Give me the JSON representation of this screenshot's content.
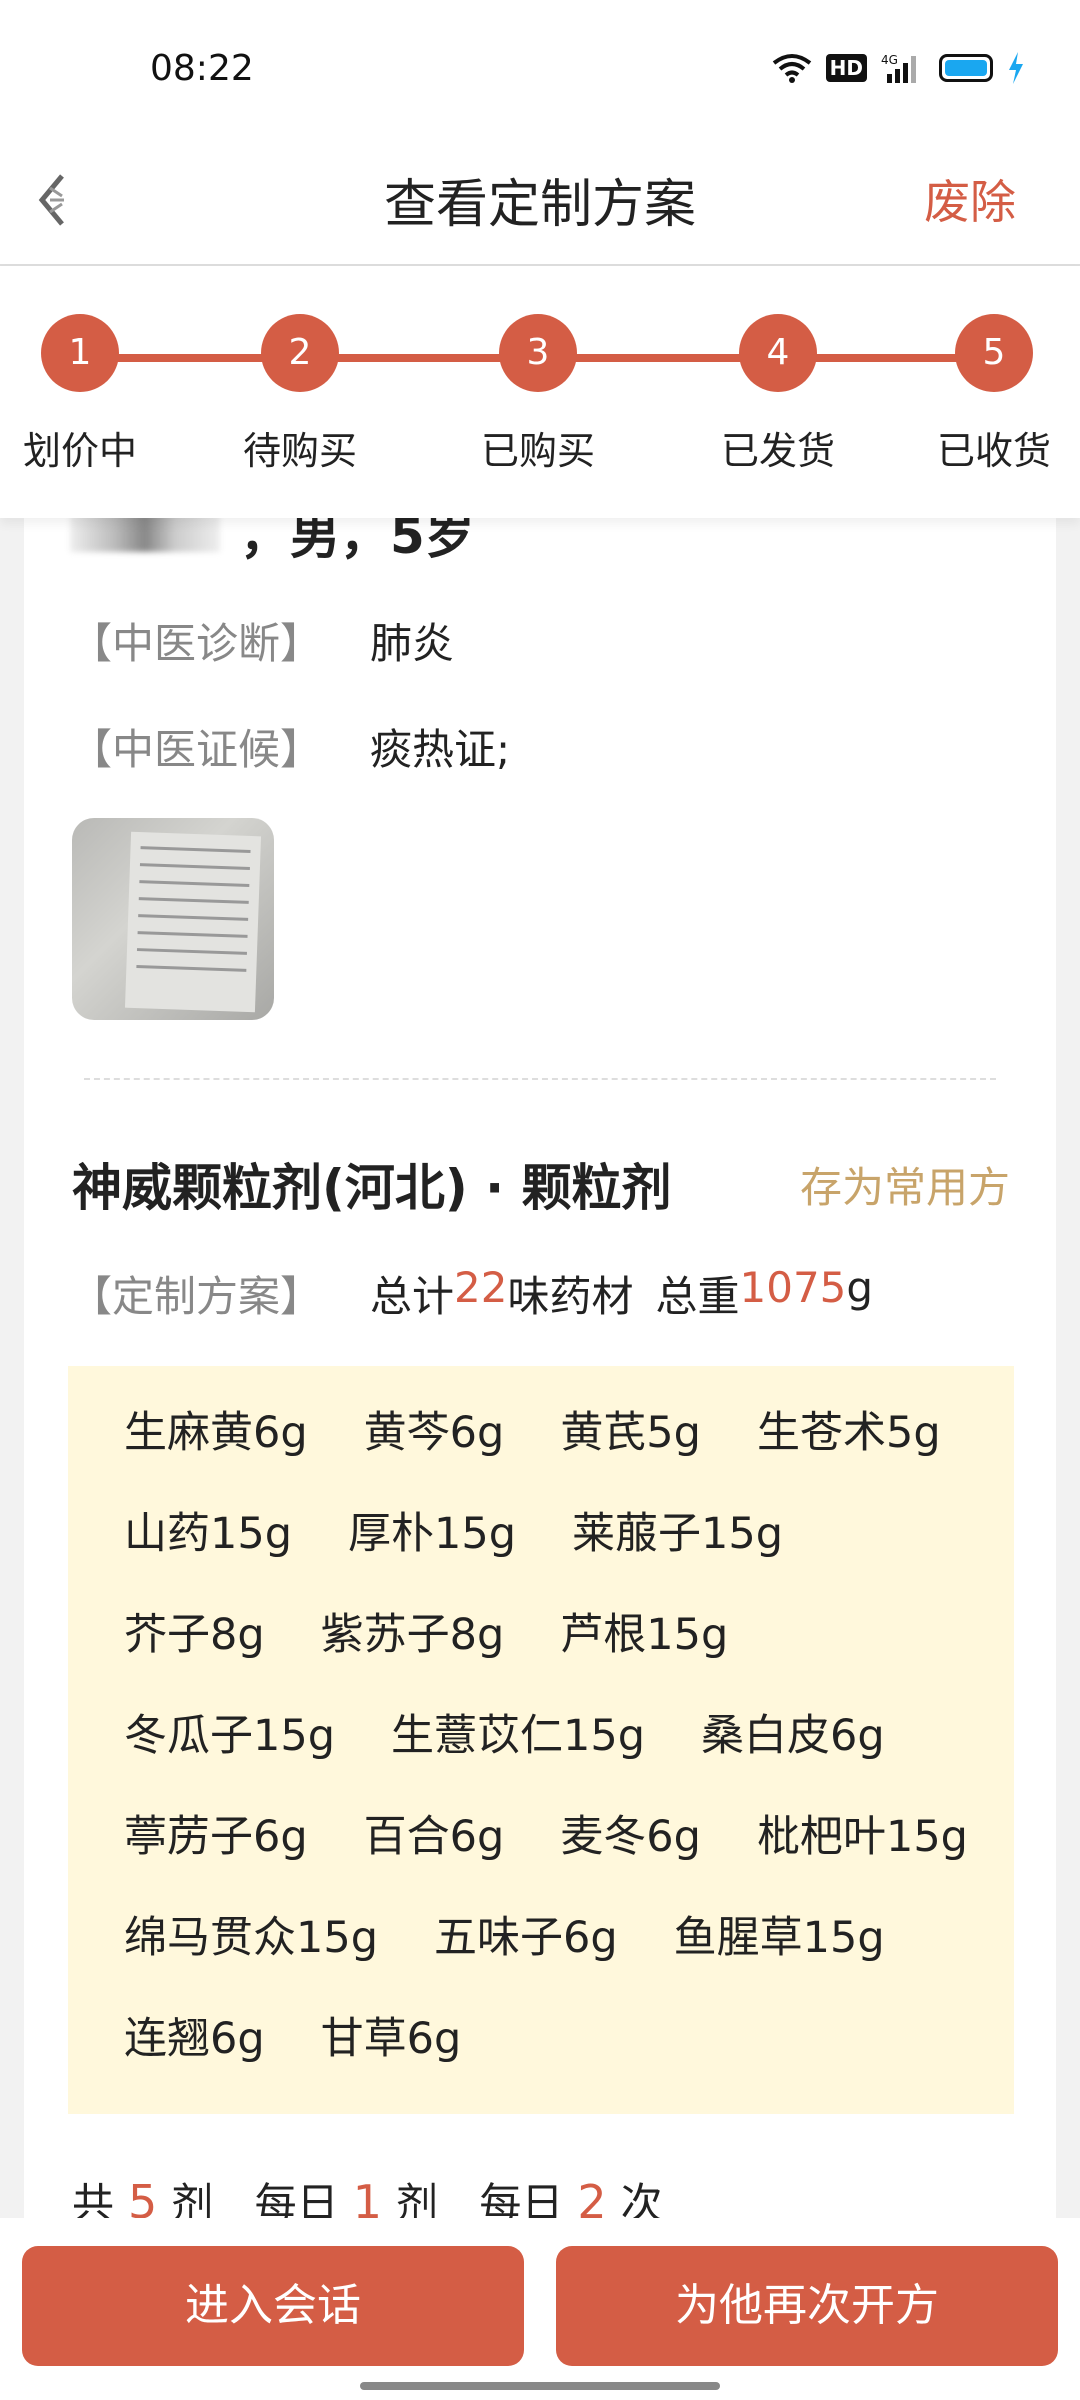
{
  "status_bar": {
    "time": "08:22",
    "hd": "HD",
    "network": "4G"
  },
  "header": {
    "title": "查看定制方案",
    "abolish_label": "废除"
  },
  "steps": [
    {
      "num": "1",
      "label": "划价中"
    },
    {
      "num": "2",
      "label": "待购买"
    },
    {
      "num": "3",
      "label": "已购买"
    },
    {
      "num": "4",
      "label": "已发货"
    },
    {
      "num": "5",
      "label": "已收货"
    }
  ],
  "patient": {
    "info": "，男，5岁"
  },
  "diagnosis": {
    "label": "【中医诊断】",
    "value": "肺炎"
  },
  "syndrome": {
    "label": "【中医证候】",
    "value": "痰热证;"
  },
  "medicine": {
    "name": "神威颗粒剂(河北) · 颗粒剂",
    "save_label": "存为常用方"
  },
  "plan": {
    "label": "【定制方案】",
    "prefix": "总计",
    "count": "22",
    "count_suffix": "味药材",
    "weight_prefix": "总重",
    "weight": "1075",
    "weight_unit": "g"
  },
  "herbs": [
    [
      "生麻黄6g",
      "黄芩6g",
      "黄芪5g",
      "生苍术5g"
    ],
    [
      "山药15g",
      "厚朴15g",
      "莱菔子15g"
    ],
    [
      "芥子8g",
      "紫苏子8g",
      "芦根15g"
    ],
    [
      "冬瓜子15g",
      "生薏苡仁15g",
      "桑白皮6g"
    ],
    [
      "葶苈子6g",
      "百合6g",
      "麦冬6g",
      "枇杷叶15g"
    ],
    [
      "绵马贯众15g",
      "五味子6g",
      "鱼腥草15g"
    ],
    [
      "连翘6g",
      "甘草6g"
    ]
  ],
  "dosage": {
    "t1": "共",
    "doses": "5",
    "t2": "剂",
    "t3": "每日",
    "per_day": "1",
    "t4": "剂",
    "t5": "每日",
    "times": "2",
    "t6": "次"
  },
  "buttons": {
    "chat": "进入会话",
    "represcribe": "为他再次开方"
  },
  "colors": {
    "accent": "#d45d45",
    "gold": "#c8a46a",
    "herb_bg": "#fff8dc"
  }
}
